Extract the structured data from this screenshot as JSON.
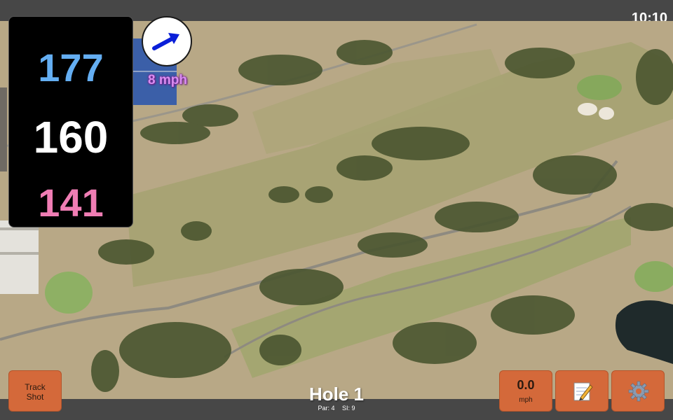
{
  "status": {
    "time": "10:10"
  },
  "distances": {
    "back": "177",
    "middle": "160",
    "front": "141"
  },
  "wind": {
    "speed_label": "8 mph",
    "icon": "wind-arrow-icon"
  },
  "hole": {
    "title": "Hole 1",
    "par_label": "Par: 4",
    "si_label": "SI: 9"
  },
  "buttons": {
    "track_shot_line1": "Track",
    "track_shot_line2": "Shot",
    "speed_value": "0.0",
    "speed_unit": "mph",
    "notes_icon": "notepad-icon",
    "settings_icon": "gear-icon"
  },
  "colors": {
    "back_distance": "#64aef2",
    "middle_distance": "#ffffff",
    "front_distance": "#f07db4",
    "button": "#d4693a",
    "wind_arrow": "#0a1fd8"
  }
}
